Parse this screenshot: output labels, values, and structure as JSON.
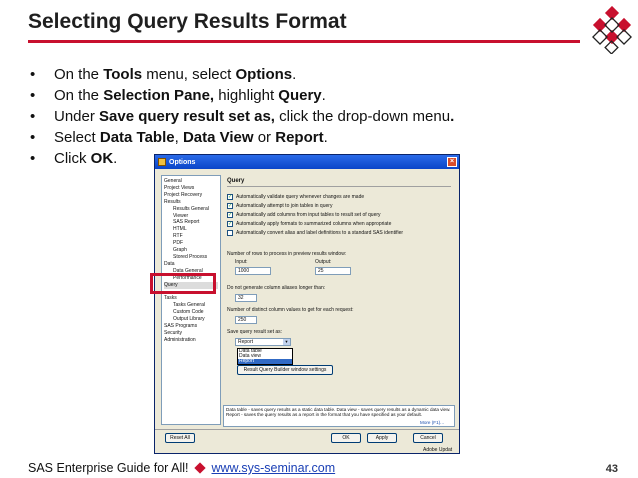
{
  "slide": {
    "title": "Selecting Query Results Format",
    "bullets": [
      {
        "pre": "On the ",
        "b1": "Tools",
        "mid": " menu, select ",
        "b2": "Options",
        "post": "."
      },
      {
        "pre": "On the ",
        "b1": "Selection Pane,",
        "mid": " highlight ",
        "b2": "Query",
        "post": "."
      },
      {
        "pre": "Under ",
        "b1": "Save query result set as,",
        "mid": " click the drop-down menu",
        "b2": ".",
        "post": ""
      },
      {
        "pre": "Select ",
        "b1": "Data Table",
        "mid": ", ",
        "b2": "Data View",
        "post": " or ",
        "b3": "Report",
        "post2": "."
      },
      {
        "pre": "Click ",
        "b1": "OK",
        "post": "."
      }
    ],
    "bullet_glyph": "•"
  },
  "window": {
    "title": "Options",
    "close_glyph": "×",
    "nav_items": [
      {
        "label": "General",
        "sub": false
      },
      {
        "label": "Project Views",
        "sub": false
      },
      {
        "label": "Project Recovery",
        "sub": false
      },
      {
        "label": "Results",
        "sub": false
      },
      {
        "label": "Results General",
        "sub": true
      },
      {
        "label": "Viewer",
        "sub": true
      },
      {
        "label": "SAS Report",
        "sub": true
      },
      {
        "label": "HTML",
        "sub": true
      },
      {
        "label": "RTF",
        "sub": true
      },
      {
        "label": "PDF",
        "sub": true
      },
      {
        "label": "Graph",
        "sub": true
      },
      {
        "label": "Stored Process",
        "sub": true
      },
      {
        "label": "Data",
        "sub": false
      },
      {
        "label": "Data General",
        "sub": true
      },
      {
        "label": "Performance",
        "sub": true
      },
      {
        "label": "Query",
        "sub": false,
        "selected": true
      },
      {
        "label": "",
        "sub": false
      },
      {
        "label": "Tasks",
        "sub": false
      },
      {
        "label": "Tasks General",
        "sub": true
      },
      {
        "label": "Custom Code",
        "sub": true
      },
      {
        "label": "Output Library",
        "sub": true
      },
      {
        "label": "SAS Programs",
        "sub": false
      },
      {
        "label": "Security",
        "sub": false
      },
      {
        "label": "Administration",
        "sub": false
      }
    ],
    "section_title": "Query",
    "checkboxes": [
      "Automatically validate query whenever changes are made",
      "Automatically attempt to join tables in query",
      "Automatically add columns from input tables to result set of query",
      "Automatically apply formats to summarized columns when appropriate",
      "Automatically convert alias and label definitions to a standard SAS identifier"
    ],
    "checked": [
      true,
      true,
      true,
      true,
      false
    ],
    "check_glyph": "✓",
    "rows_label": "Number of rows to process in preview results window:",
    "input_label": "Input:",
    "output_label": "Output:",
    "input_value": "1000",
    "output_value": "25",
    "alias_label": "Do not generate column aliases longer than:",
    "alias_value": "32",
    "distinct_label": "Number of distinct column values to get for each request:",
    "distinct_value": "250",
    "save_label": "Save query result set as:",
    "save_value": "Report",
    "dropdown_options": [
      "Data table",
      "Data view",
      "Report"
    ],
    "dropdown_arrow": "▼",
    "partial_button": "Result Query Builder window settings",
    "description": "Data table - saves query results as a static data table. Data view - saves query results as a dynamic data view. Report - saves the query results as a report in the format that you have specified as your default.",
    "more": "More (F1)...",
    "buttons": {
      "reset": "Reset All",
      "ok": "OK",
      "apply": "Apply",
      "cancel": "Cancel"
    },
    "adobe": "Adobe Updat"
  },
  "footer": {
    "text": "SAS Enterprise Guide for All!",
    "link": "www.sys-seminar.com",
    "page": "43"
  },
  "colors": {
    "accent": "#c8102e",
    "link": "#1a3fb5"
  }
}
